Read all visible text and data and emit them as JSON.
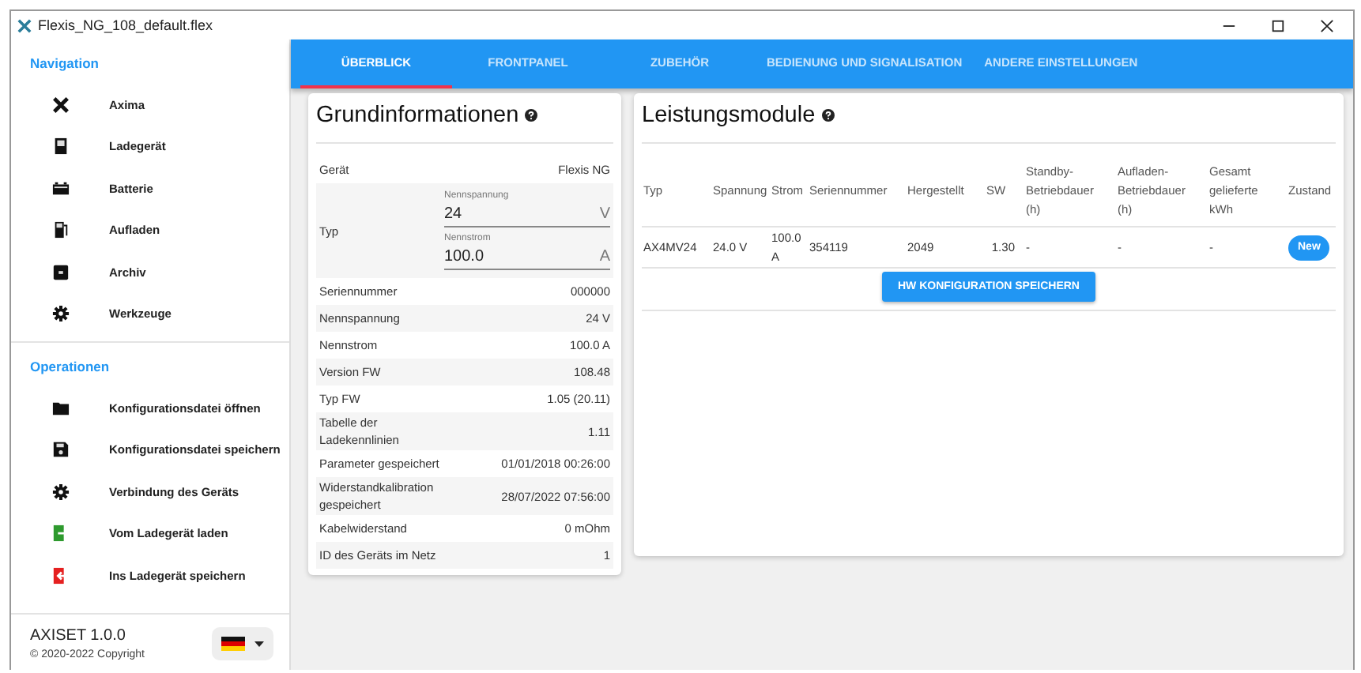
{
  "window": {
    "title": "Flexis_NG_108_default.flex"
  },
  "sidebar": {
    "sections": [
      {
        "title": "Navigation",
        "items": [
          {
            "label": "Axima",
            "kind": "x"
          },
          {
            "label": "Ladegerät",
            "kind": "charger"
          },
          {
            "label": "Batterie",
            "kind": "battery"
          },
          {
            "label": "Aufladen",
            "kind": "pump"
          },
          {
            "label": "Archiv",
            "kind": "archive"
          },
          {
            "label": "Werkzeuge",
            "kind": "gear"
          }
        ]
      },
      {
        "title": "Operationen",
        "items": [
          {
            "label": "Konfigurationsdatei öffnen",
            "kind": "folder"
          },
          {
            "label": "Konfigurationsdatei speichern",
            "kind": "save"
          },
          {
            "label": "Verbindung des Geräts",
            "kind": "gear"
          },
          {
            "label": "Vom Ladegerät laden",
            "kind": "import"
          },
          {
            "label": "Ins Ladegerät speichern",
            "kind": "export"
          }
        ]
      }
    ],
    "app_name": "AXISET 1.0.0",
    "copyright": "© 2020-2022 Copyright"
  },
  "tabs": [
    {
      "label": "ÜBERBLICK",
      "selected": true
    },
    {
      "label": "FRONTPANEL",
      "selected": false
    },
    {
      "label": "ZUBEHÖR",
      "selected": false
    },
    {
      "label": "BEDIENUNG UND SIGNALISATION",
      "selected": false
    },
    {
      "label": "ANDERE EINSTELLUNGEN",
      "selected": false
    }
  ],
  "basic_info": {
    "title": "Grundinformationen",
    "rows": [
      {
        "kind": "text",
        "label": "Gerät",
        "value": "Flexis NG"
      },
      {
        "kind": "fields",
        "label": "Typ",
        "fields": [
          {
            "label": "Nennspannung",
            "value": "24",
            "unit": "V"
          },
          {
            "label": "Nennstrom",
            "value": "100.0",
            "unit": "A"
          }
        ]
      },
      {
        "kind": "text",
        "label": "Seriennummer",
        "value": "000000"
      },
      {
        "kind": "text",
        "label": "Nennspannung",
        "value": "24 V"
      },
      {
        "kind": "text",
        "label": "Nennstrom",
        "value": "100.0 A"
      },
      {
        "kind": "text",
        "label": "Version FW",
        "value": "108.48"
      },
      {
        "kind": "text",
        "label": "Typ FW",
        "value": "1.05 (20.11)"
      },
      {
        "kind": "text",
        "label": "Tabelle der Ladekennlinien",
        "value": "1.11"
      },
      {
        "kind": "text",
        "label": "Parameter gespeichert",
        "value": "01/01/2018 00:26:00"
      },
      {
        "kind": "text",
        "label": "Widerstandkalibration gespeichert",
        "value": "28/07/2022 07:56:00"
      },
      {
        "kind": "text",
        "label": "Kabelwiderstand",
        "value": "0 mOhm"
      },
      {
        "kind": "text",
        "label": "ID des Geräts im Netz",
        "value": "1"
      }
    ]
  },
  "power_modules": {
    "title": "Leistungsmodule",
    "columns": [
      "Typ",
      "Spannung",
      "Strom",
      "Seriennummer",
      "Hergestellt",
      "SW",
      "Standby-Betriebdauer (h)",
      "Aufladen-Betriebdauer (h)",
      "Gesamt gelieferte kWh",
      "Zustand"
    ],
    "rows": [
      {
        "cells": [
          "AX4MV24",
          "24.0 V",
          "100.0 A",
          "354119",
          "2049",
          "1.30",
          "-",
          "-",
          "-"
        ],
        "status": "New"
      }
    ],
    "button": "HW KONFIGURATION SPEICHERN"
  }
}
